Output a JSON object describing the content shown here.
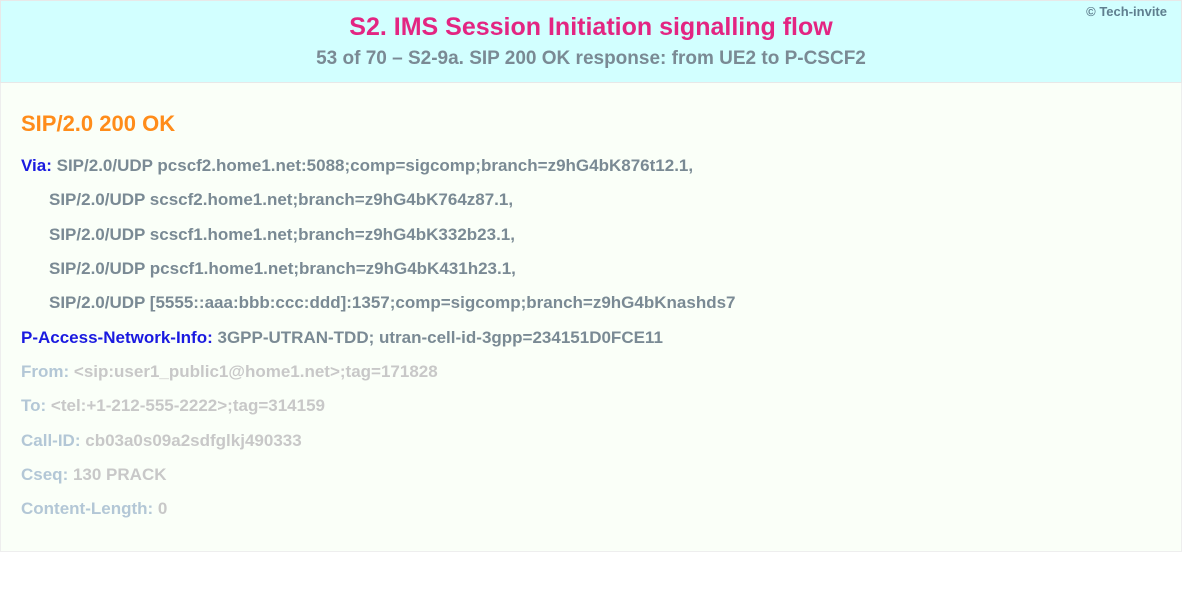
{
  "header": {
    "copyright": "© Tech-invite",
    "title": "S2. IMS Session Initiation signalling flow",
    "subtitle": "53 of 70 – S2-9a. SIP 200 OK response: from UE2 to P-CSCF2"
  },
  "sip": {
    "status_line": "SIP/2.0 200 OK",
    "via_label": "Via",
    "via_first": "SIP/2.0/UDP pcscf2.home1.net:5088;comp=sigcomp;branch=z9hG4bK876t12.1,",
    "via_rest": [
      "SIP/2.0/UDP scscf2.home1.net;branch=z9hG4bK764z87.1,",
      "SIP/2.0/UDP scscf1.home1.net;branch=z9hG4bK332b23.1,",
      "SIP/2.0/UDP pcscf1.home1.net;branch=z9hG4bK431h23.1,",
      "SIP/2.0/UDP [5555::aaa:bbb:ccc:ddd]:1357;comp=sigcomp;branch=z9hG4bKnashds7"
    ],
    "pani_label": "P-Access-Network-Info",
    "pani_value": "3GPP-UTRAN-TDD; utran-cell-id-3gpp=234151D0FCE11",
    "dim_headers": [
      {
        "name": "From",
        "value": "<sip:user1_public1@home1.net>;tag=171828"
      },
      {
        "name": "To",
        "value": "<tel:+1-212-555-2222>;tag=314159"
      },
      {
        "name": "Call-ID",
        "value": "cb03a0s09a2sdfglkj490333"
      },
      {
        "name": "Cseq",
        "value": "130 PRACK"
      },
      {
        "name": "Content-Length",
        "value": "0"
      }
    ]
  }
}
